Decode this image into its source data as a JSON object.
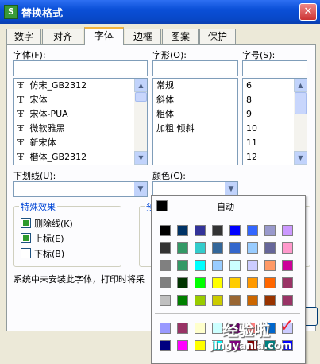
{
  "window": {
    "title": "替换格式",
    "app_icon": "S",
    "close": "✕"
  },
  "tabs": [
    "数字",
    "对齐",
    "字体",
    "边框",
    "图案",
    "保护"
  ],
  "active_tab": "字体",
  "font": {
    "label": "字体(F):",
    "value": "",
    "items": [
      "仿宋_GB2312",
      "宋体",
      "宋体-PUA",
      "微软雅黑",
      "新宋体",
      "楷体_GB2312"
    ]
  },
  "style": {
    "label": "字形(O):",
    "value": "",
    "items": [
      "常规",
      "斜体",
      "粗体",
      "加粗 倾斜"
    ]
  },
  "size": {
    "label": "字号(S):",
    "value": "",
    "items": [
      "6",
      "8",
      "9",
      "10",
      "11",
      "12"
    ]
  },
  "underline": {
    "label": "下划线(U):",
    "value": ""
  },
  "color": {
    "label": "颜色(C):",
    "value": ""
  },
  "effects": {
    "title": "特殊效果",
    "items": [
      {
        "label": "删除线(K)",
        "checked": true
      },
      {
        "label": "上标(E)",
        "checked": true
      },
      {
        "label": "下标(B)",
        "checked": false
      }
    ]
  },
  "preview_title_partial": "预",
  "note": "系统中未安装此字体，打印时将采",
  "color_popup": {
    "auto_label": "自动",
    "auto_color": "#000000",
    "rows": [
      [
        "#000000",
        "#003366",
        "#333399",
        "#333333",
        "#0000ff",
        "#3366ff",
        "#9999cc",
        "#cc99ff"
      ],
      [
        "#333333",
        "#339966",
        "#33cccc",
        "#336699",
        "#3366cc",
        "#99ccff",
        "#666699",
        "#ff99cc"
      ],
      [
        "#808080",
        "#339966",
        "#00ffff",
        "#99ccff",
        "#ccffff",
        "#ccccff",
        "#ff9966",
        "#cc0099"
      ],
      [
        "#808080",
        "#003300",
        "#00ff00",
        "#ffff00",
        "#ffcc00",
        "#ff9900",
        "#ff6600",
        "#993366"
      ],
      [
        "#c0c0c0",
        "#008000",
        "#99cc00",
        "#cccc00",
        "#996633",
        "#cc6600",
        "#993300",
        "#993366"
      ]
    ],
    "extra_rows": [
      [
        "#9999ff",
        "#993366",
        "#ffffcc",
        "#ccffff",
        "#660066",
        "#ff8080",
        "#0066cc",
        "#ccccff"
      ],
      [
        "#000080",
        "#ff00ff",
        "#ffff00",
        "#00ffff",
        "#800080",
        "#800000",
        "#008080",
        "#0000ff"
      ]
    ]
  },
  "watermark": {
    "brand": "经验啦",
    "check": "✓",
    "url": "jingyanla.com"
  }
}
